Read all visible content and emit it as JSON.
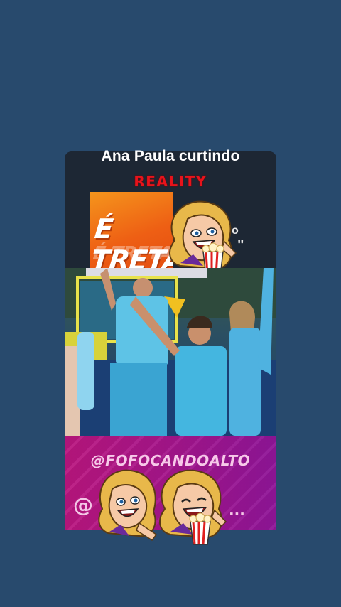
{
  "post": {
    "title": "Ana Paula curtindo",
    "badge": "REALITY",
    "sticker_text": "É TRETA!",
    "sticker_ghost": "É TRETA",
    "handle": "@FOFOCANDOALTO",
    "at_symbol": "@",
    "ellipsis": "...",
    "quote_mark_1": "o",
    "quote_mark_2": "\""
  },
  "icons": [
    "cartoon-blonde-woman-popcorn-icon",
    "cartoon-blonde-woman-laughing-icon",
    "popcorn-bucket-icon"
  ],
  "colors": {
    "background": "#284a6d",
    "badge_red": "#e8131b",
    "sticker_orange": "#ee5f14",
    "promo_magenta": "#a0157e",
    "outfit_blue": "#44b6e0"
  }
}
